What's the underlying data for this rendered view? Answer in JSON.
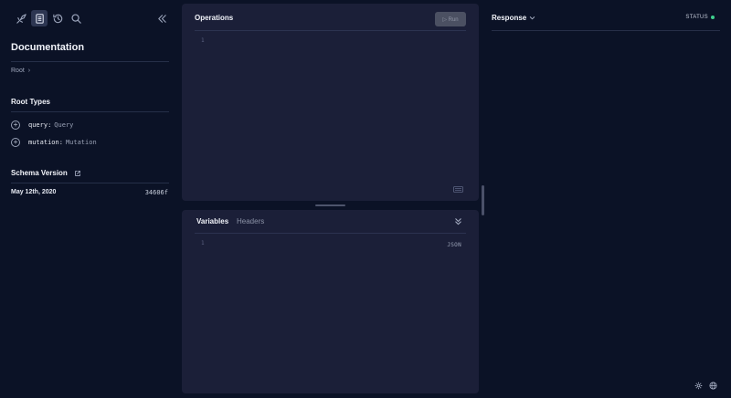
{
  "toolbar": {
    "icons": [
      "explorer-icon",
      "documentation-icon",
      "history-icon",
      "search-icon"
    ],
    "collapse_icon": "chevrons-left-icon"
  },
  "documentation": {
    "title": "Documentation",
    "breadcrumb": "Root",
    "breadcrumb_sep": "›",
    "root_types_title": "Root Types",
    "root_types": [
      {
        "name": "query:",
        "type": "Query"
      },
      {
        "name": "mutation:",
        "type": "Mutation"
      }
    ],
    "schema_version_title": "Schema Version",
    "schema_date": "May 12th, 2020",
    "schema_hash": "34606f"
  },
  "operations": {
    "title": "Operations",
    "run_label": "▷ Run",
    "line_number": "1"
  },
  "variables": {
    "tab_variables": "Variables",
    "tab_headers": "Headers",
    "line_number": "1",
    "format_label": "JSON"
  },
  "response": {
    "title": "Response",
    "status_label": "STATUS",
    "status_color": "#3ecf8e"
  },
  "colors": {
    "background": "#0b1226",
    "panel": "#1b1f38",
    "run_button": "#4b5062"
  }
}
